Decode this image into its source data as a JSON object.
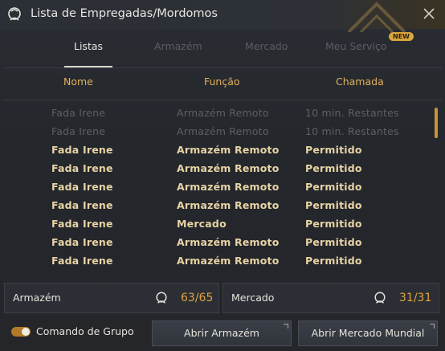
{
  "window": {
    "title": "Lista de Empregadas/Mordomos"
  },
  "tabs": [
    {
      "label": "Listas"
    },
    {
      "label": "Armazém"
    },
    {
      "label": "Mercado"
    },
    {
      "label": "Meu Serviço"
    }
  ],
  "new_badge": "NEW",
  "columns": {
    "name": "Nome",
    "function": "Função",
    "call": "Chamada"
  },
  "rows": [
    {
      "name": "Fada Irene",
      "function": "Armazém Remoto",
      "call": "10 min. Restantes"
    },
    {
      "name": "Fada Irene",
      "function": "Armazém Remoto",
      "call": "10 min. Restantes"
    },
    {
      "name": "Fada Irene",
      "function": "Armazém Remoto",
      "call": "Permitido"
    },
    {
      "name": "Fada Irene",
      "function": "Armazém Remoto",
      "call": "Permitido"
    },
    {
      "name": "Fada Irene",
      "function": "Armazém Remoto",
      "call": "Permitido"
    },
    {
      "name": "Fada Irene",
      "function": "Armazém Remoto",
      "call": "Permitido"
    },
    {
      "name": "Fada Irene",
      "function": "Mercado",
      "call": "Permitido"
    },
    {
      "name": "Fada Irene",
      "function": "Armazém Remoto",
      "call": "Permitido"
    },
    {
      "name": "Fada Irene",
      "function": "Armazém Remoto",
      "call": "Permitido"
    }
  ],
  "storage": {
    "label": "Armazém",
    "count": "63/65"
  },
  "market": {
    "label": "Mercado",
    "count": "31/31"
  },
  "group_command": {
    "label": "Comando de Grupo",
    "enabled": true
  },
  "buttons": {
    "open_storage": "Abrir Armazém",
    "open_market": "Abrir Mercado Mundial"
  },
  "colors": {
    "accent": "#e0a43e",
    "header_gold": "#e0b15a",
    "active_text": "#e7d3a5",
    "dim_text": "#5e5f62"
  },
  "icons": {
    "title": "maid-icon",
    "close": "close-icon",
    "storage": "maid-icon",
    "market": "maid-icon"
  }
}
